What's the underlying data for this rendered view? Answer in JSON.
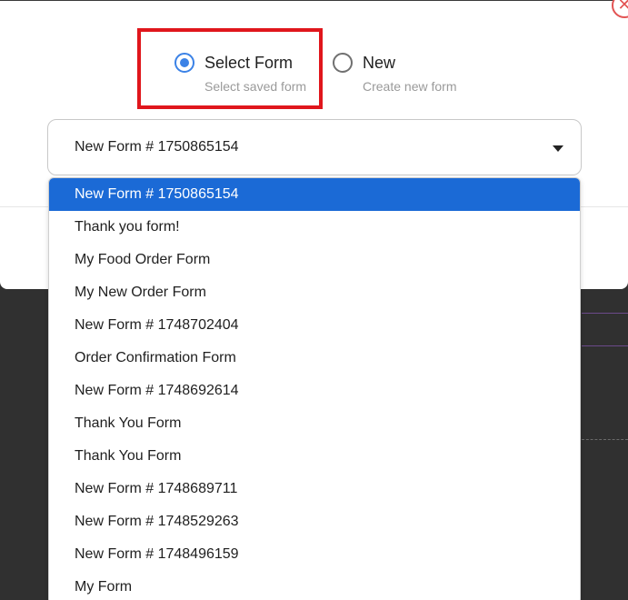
{
  "modal": {
    "close_icon": "close-icon",
    "close_glyph": "✕",
    "source_options": [
      {
        "label": "Select Form",
        "sublabel": "Select saved form",
        "checked": true
      },
      {
        "label": "New",
        "sublabel": "Create new form",
        "checked": false
      }
    ],
    "highlight_color": "#e0161c"
  },
  "form_select": {
    "value": "New Form # 1750865154",
    "caret_icon": "caret-down-icon",
    "options": [
      "New Form # 1750865154",
      "Thank you form!",
      "My Food Order Form",
      "My New Order Form",
      "New Form # 1748702404",
      "Order Confirmation Form",
      "New Form # 1748692614",
      "Thank You Form",
      "Thank You Form",
      "New Form # 1748689711",
      "New Form # 1748529263",
      "New Form # 1748496159",
      "My Form"
    ],
    "selected_index": 0,
    "selected_color": "#1b6ad6"
  }
}
